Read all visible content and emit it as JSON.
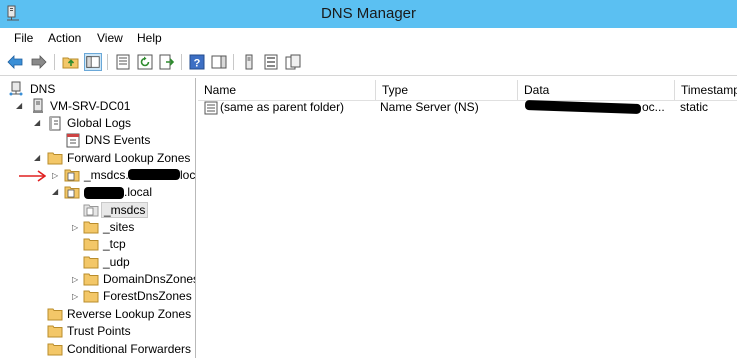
{
  "window": {
    "title": "DNS Manager"
  },
  "menu": {
    "file": "File",
    "action": "Action",
    "view": "View",
    "help": "Help"
  },
  "tree": {
    "root": "DNS",
    "server": "VM-SRV-DC01",
    "global_logs": "Global Logs",
    "dns_events": "DNS Events",
    "forward_zones": "Forward Lookup Zones",
    "msdcs_zone": "_msdcs.",
    "msdcs_zone_suffix": "loc",
    "domain_zone": ".local",
    "msdcs": "_msdcs",
    "sites": "_sites",
    "tcp": "_tcp",
    "udp": "_udp",
    "domain_dns_zones": "DomainDnsZones",
    "forest_dns_zones": "ForestDnsZones",
    "reverse_zones": "Reverse Lookup Zones",
    "trust_points": "Trust Points",
    "conditional_forwarders": "Conditional Forwarders"
  },
  "list": {
    "columns": [
      "Name",
      "Type",
      "Data",
      "Timestamp"
    ],
    "rows": [
      {
        "name": "(same as parent folder)",
        "type": "Name Server (NS)",
        "data": "oc...",
        "timestamp": "static"
      }
    ]
  },
  "colors": {
    "titlebar": "#5bc0f2",
    "folder": "#f3c768",
    "annotation_arrow": "#e02020"
  }
}
